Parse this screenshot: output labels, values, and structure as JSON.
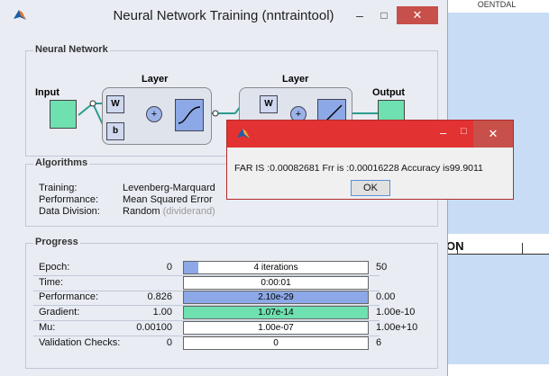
{
  "main_window": {
    "title": "Neural Network Training (nntraintool)",
    "controls": {
      "minimize": "–",
      "maximize": "□",
      "close": "✕"
    }
  },
  "background_window": {
    "top_text": "OENTDAL",
    "label": "ON"
  },
  "neural_network": {
    "section_label": "Neural Network",
    "input_label": "Input",
    "output_label": "Output",
    "layer_labels": [
      "Layer",
      "Layer"
    ],
    "w_label": "W",
    "b_label": "b",
    "plus_label": "+"
  },
  "algorithms": {
    "section_label": "Algorithms",
    "rows": [
      {
        "label": "Training:",
        "value": "Levenberg-Marquard",
        "extra": ""
      },
      {
        "label": "Performance:",
        "value": "Mean Squared Error",
        "extra": ""
      },
      {
        "label": "Data Division:",
        "value": "Random",
        "extra": "(dividerand)"
      }
    ]
  },
  "progress": {
    "section_label": "Progress",
    "rows": [
      {
        "label": "Epoch:",
        "start": "0",
        "bar_text": "4 iterations",
        "end": "50",
        "fill": 0.08,
        "fill_color": "#8ca8e6"
      },
      {
        "label": "Time:",
        "start": "",
        "bar_text": "0:00:01",
        "end": "",
        "fill": 0,
        "fill_color": "#8ca8e6"
      },
      {
        "label": "Performance:",
        "start": "0.826",
        "bar_text": "2.10e-29",
        "end": "0.00",
        "fill": 1,
        "fill_color": "#8ca8e6"
      },
      {
        "label": "Gradient:",
        "start": "1.00",
        "bar_text": "1.07e-14",
        "end": "1.00e-10",
        "fill": 1,
        "fill_color": "#6fe0b0"
      },
      {
        "label": "Mu:",
        "start": "0.00100",
        "bar_text": "1.00e-07",
        "end": "1.00e+10",
        "fill": 0,
        "fill_color": "#8ca8e6"
      },
      {
        "label": "Validation Checks:",
        "start": "0",
        "bar_text": "0",
        "end": "6",
        "fill": 0,
        "fill_color": "#8ca8e6"
      }
    ]
  },
  "dialog": {
    "message": "FAR IS :0.00082681 Frr is :0.00016228 Accuracy is99.9011",
    "ok_label": "OK",
    "controls": {
      "minimize": "–",
      "maximize": "□",
      "close": "✕"
    }
  },
  "colors": {
    "window_bg": "#e9ecf3",
    "dialog_titlebar": "#e23232",
    "close_button": "#c7504a",
    "bar_blue": "#8ca8e6",
    "bar_green": "#6fe0b0",
    "background_blue": "#c9dcf5"
  },
  "icons": [
    "matlab-icon",
    "close-icon",
    "maximize-icon",
    "minimize-icon",
    "sigmoid-icon",
    "linear-icon"
  ]
}
